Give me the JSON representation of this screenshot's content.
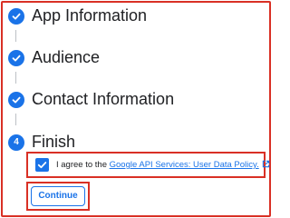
{
  "steps": [
    {
      "label": "App Information",
      "status": "complete"
    },
    {
      "label": "Audience",
      "status": "complete"
    },
    {
      "label": "Contact Information",
      "status": "complete"
    },
    {
      "label": "Finish",
      "status": "current",
      "number": "4"
    }
  ],
  "consent": {
    "checked": true,
    "text": "I agree to the ",
    "link_text": "Google API Services: User Data Policy."
  },
  "actions": {
    "continue_label": "Continue"
  },
  "colors": {
    "accent": "#1a73e8",
    "highlight": "#d93025"
  }
}
